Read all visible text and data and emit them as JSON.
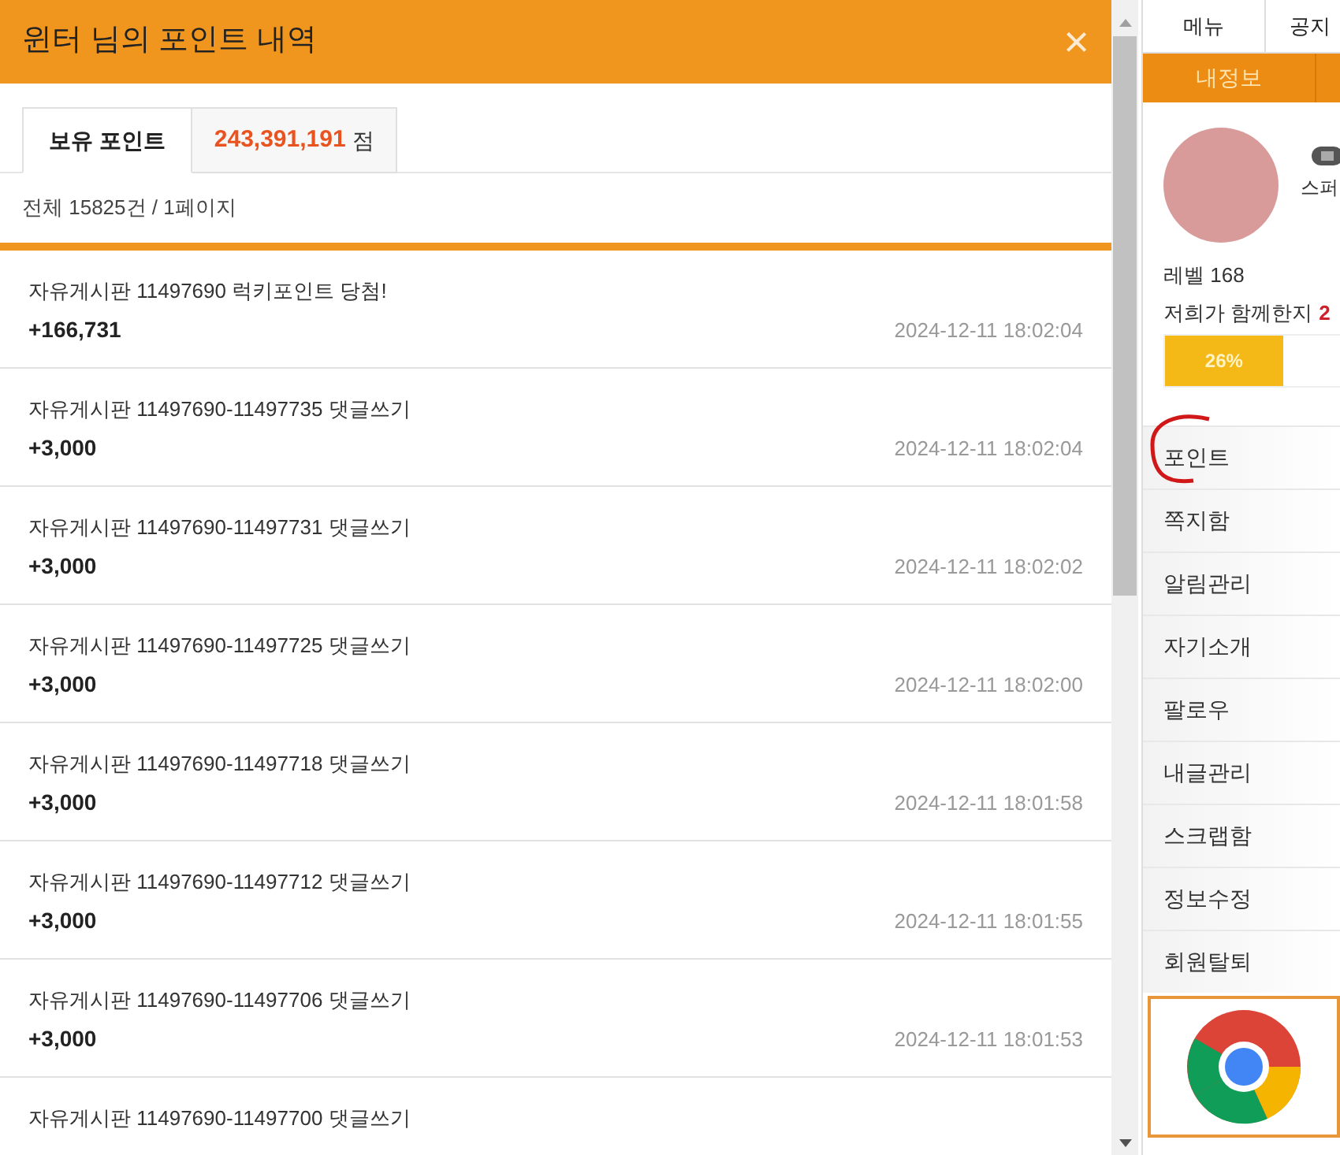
{
  "dialog": {
    "title": "윈터 님의 포인트 내역",
    "close": "×"
  },
  "tabs": [
    {
      "label": "보유 포인트",
      "selected": true
    }
  ],
  "balance": {
    "amount": "243,391,191",
    "unit": "점"
  },
  "summary": "전체 15825건 / 1페이지",
  "entries": [
    {
      "description": "자유게시판 11497690 럭키포인트 당첨!",
      "amount": "+166,731",
      "date": "2024-12-11 18:02:04"
    },
    {
      "description": "자유게시판 11497690-11497735 댓글쓰기",
      "amount": "+3,000",
      "date": "2024-12-11 18:02:04"
    },
    {
      "description": "자유게시판 11497690-11497731 댓글쓰기",
      "amount": "+3,000",
      "date": "2024-12-11 18:02:02"
    },
    {
      "description": "자유게시판 11497690-11497725 댓글쓰기",
      "amount": "+3,000",
      "date": "2024-12-11 18:02:00"
    },
    {
      "description": "자유게시판 11497690-11497718 댓글쓰기",
      "amount": "+3,000",
      "date": "2024-12-11 18:01:58"
    },
    {
      "description": "자유게시판 11497690-11497712 댓글쓰기",
      "amount": "+3,000",
      "date": "2024-12-11 18:01:55"
    },
    {
      "description": "자유게시판 11497690-11497706 댓글쓰기",
      "amount": "+3,000",
      "date": "2024-12-11 18:01:53"
    },
    {
      "description": "자유게시판 11497690-11497700 댓글쓰기"
    }
  ],
  "sidebar": {
    "top_tabs": [
      "메뉴",
      "공지"
    ],
    "section_tab": "내정보",
    "nickname": "스퍼",
    "level": "레벨 168",
    "together": "저희가 함께한지",
    "days": "2",
    "progress": {
      "level": 0.26,
      "label": "26%"
    },
    "menu": [
      {
        "label": "포인트",
        "circled": true
      },
      {
        "label": "쪽지함",
        "circled": false
      },
      {
        "label": "알림관리",
        "circled": false
      },
      {
        "label": "자기소개",
        "circled": false
      },
      {
        "label": "팔로우",
        "circled": false
      },
      {
        "label": "내글관리",
        "circled": false
      },
      {
        "label": "스크랩함",
        "circled": false
      },
      {
        "label": "정보수정",
        "circled": false
      },
      {
        "label": "회원탈퇴",
        "circled": false
      }
    ]
  }
}
